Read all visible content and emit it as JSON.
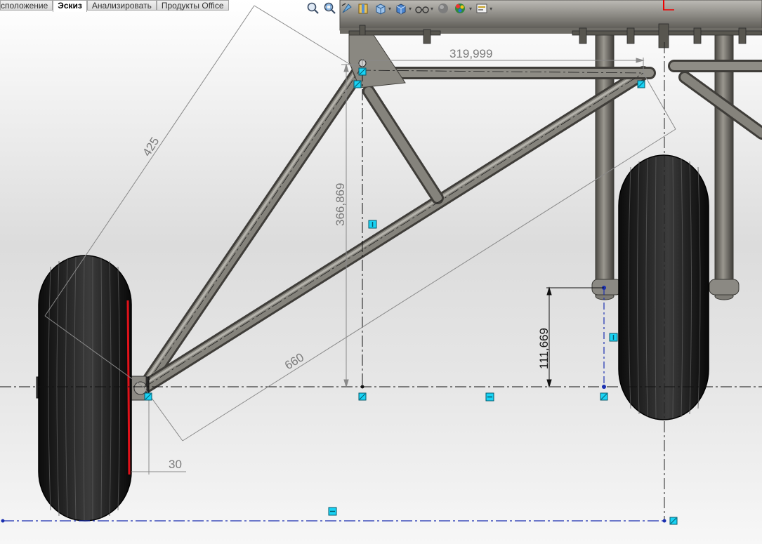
{
  "tabs": [
    {
      "label": "сположение",
      "active": false
    },
    {
      "label": "Эскиз",
      "active": true
    },
    {
      "label": "Анализировать",
      "active": false
    },
    {
      "label": "Продукты Office",
      "active": false
    }
  ],
  "heads_up_toolbar": [
    "zoom-to-fit-icon",
    "zoom-to-area-icon",
    "previous-view-icon",
    "section-view-icon",
    "view-orientation-icon",
    "display-style-icon",
    "hide-show-items-icon",
    "edit-appearance-icon",
    "apply-scene-icon",
    "view-settings-icon"
  ],
  "dimensions": {
    "d_top": "319,999",
    "d_diag": "425",
    "d_vert": "366,869",
    "d_long": "660",
    "d_small": "30",
    "d_right": "111,669"
  },
  "colors": {
    "accent_cyan": "#19d3f5",
    "sketch_blue": "#1a2fb0",
    "selection_red": "#e0121a",
    "tube_gray": "#6f6d68",
    "tire_black": "#1b1b1b"
  }
}
